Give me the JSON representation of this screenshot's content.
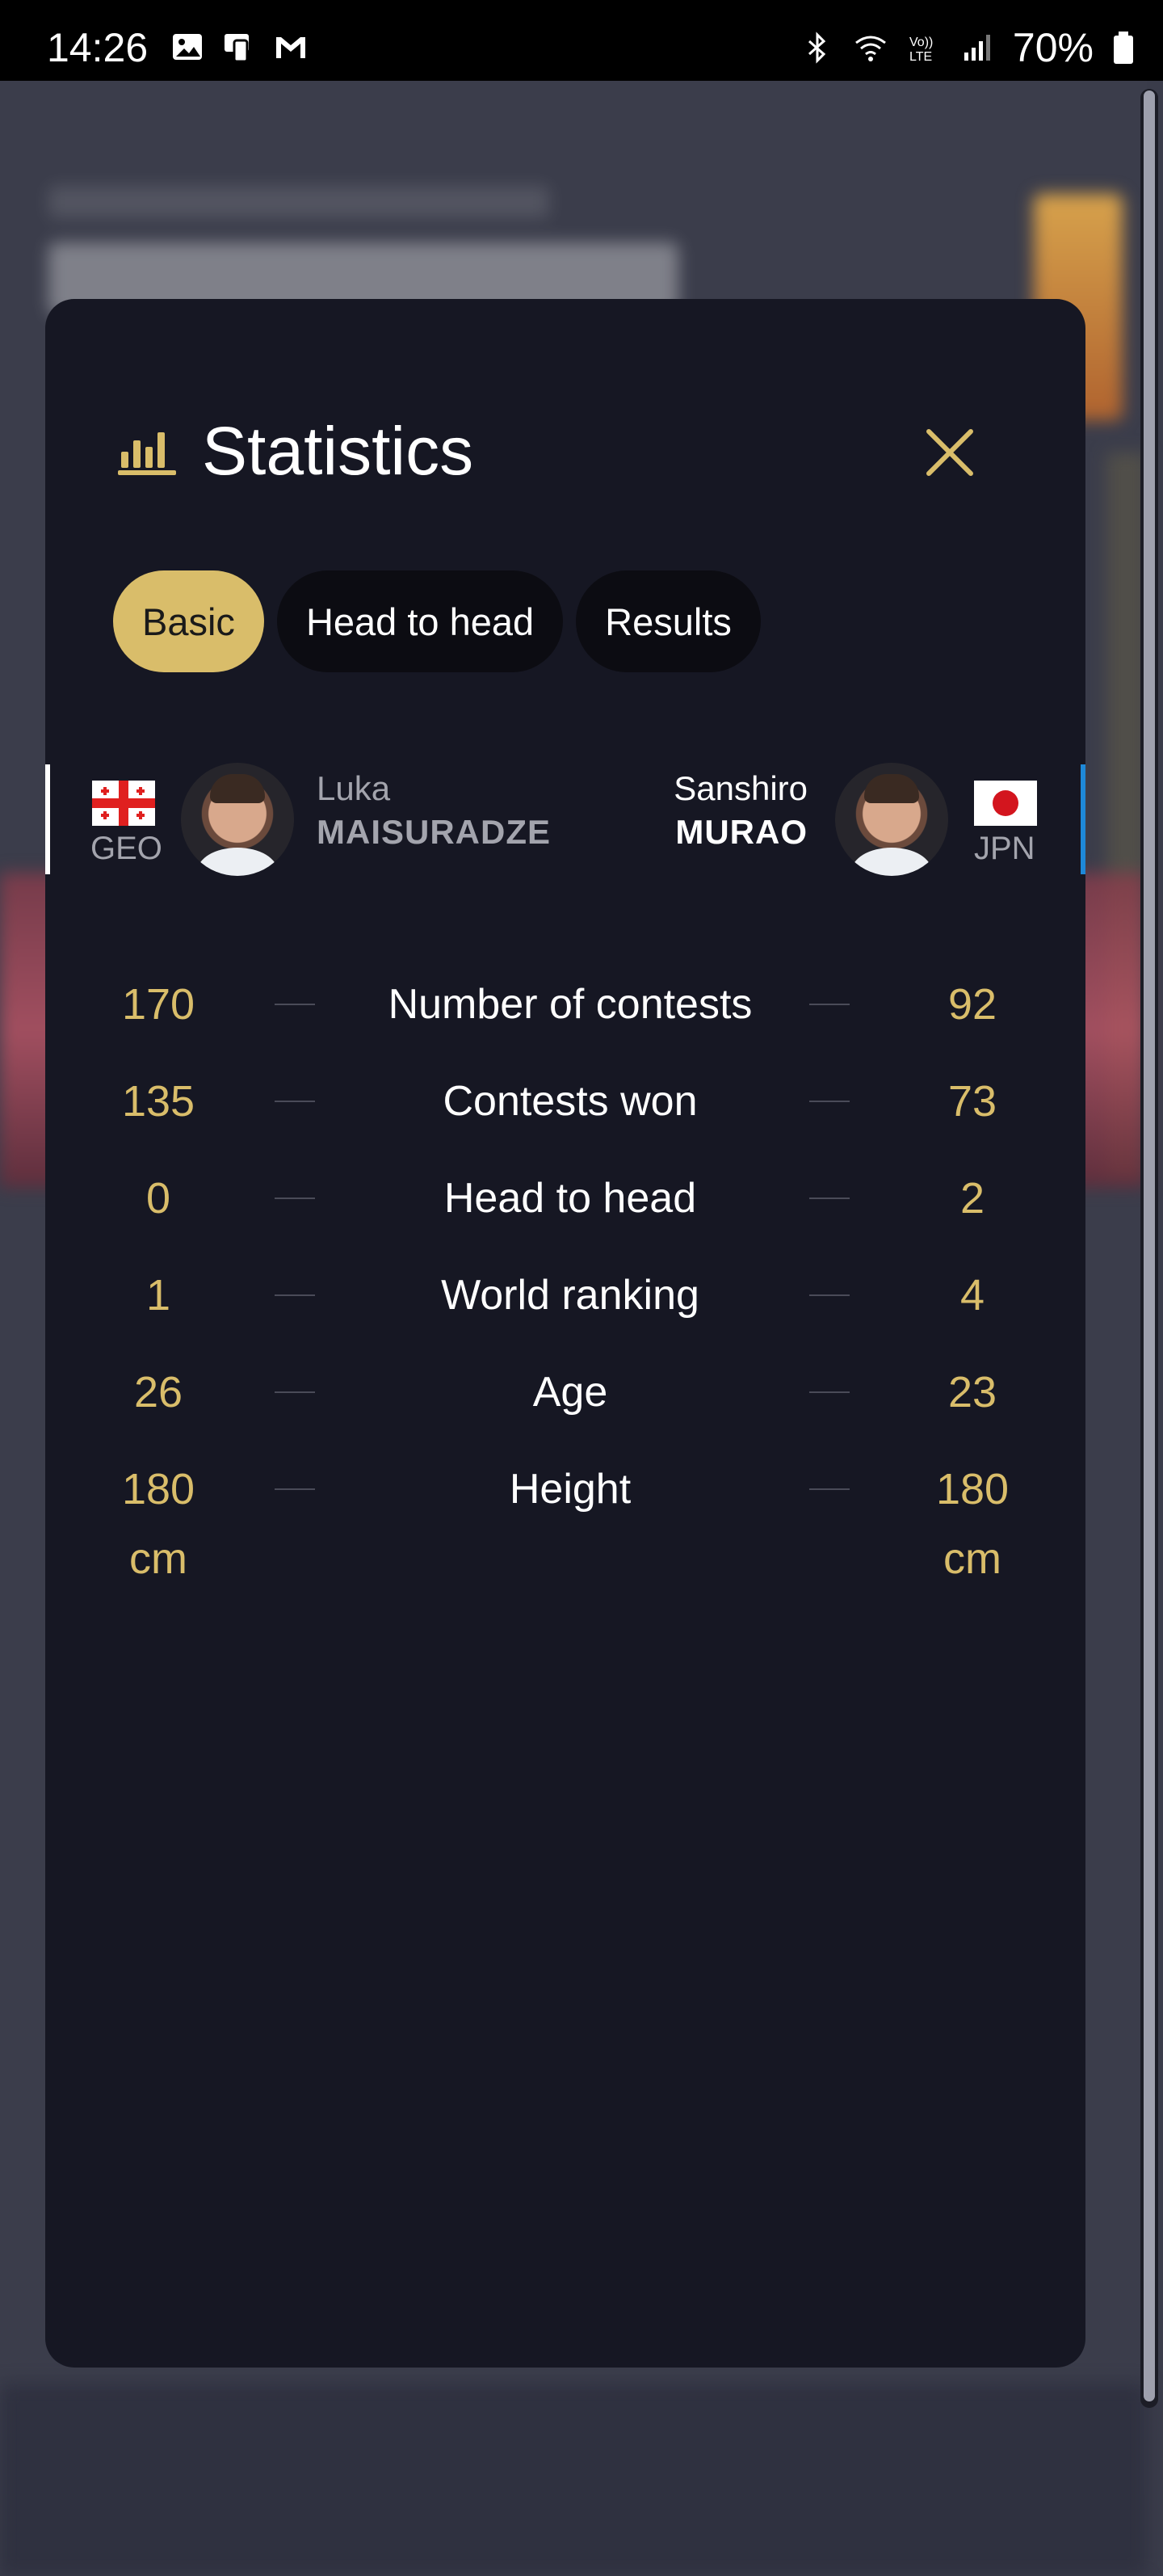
{
  "status_bar": {
    "time": "14:26",
    "battery": "70%",
    "left_icons": [
      "image-icon",
      "cast-icon",
      "gmail-icon"
    ],
    "right_icons": [
      "bluetooth-icon",
      "wifi-icon",
      "volte-icon",
      "signal-icon",
      "battery-icon"
    ]
  },
  "modal": {
    "title": "Statistics",
    "title_icon": "bar-chart-icon",
    "close_icon": "close-icon",
    "tabs": [
      {
        "label": "Basic",
        "active": true
      },
      {
        "label": "Head to head",
        "active": false
      },
      {
        "label": "Results",
        "active": false
      }
    ]
  },
  "athletes": {
    "left": {
      "country": "GEO",
      "first_name": "Luka",
      "last_name": "MAISURADZE",
      "flag": "georgia-flag"
    },
    "right": {
      "country": "JPN",
      "first_name": "Sanshiro",
      "last_name": "MURAO",
      "flag": "japan-flag"
    }
  },
  "stats": [
    {
      "label": "Number of contests",
      "left": "170",
      "right": "92"
    },
    {
      "label": "Contests won",
      "left": "135",
      "right": "73"
    },
    {
      "label": "Head to head",
      "left": "0",
      "right": "2"
    },
    {
      "label": "World ranking",
      "left": "1",
      "right": "4"
    },
    {
      "label": "Age",
      "left": "26",
      "right": "23"
    },
    {
      "label": "Height",
      "left": "180",
      "left_unit": "cm",
      "right": "180",
      "right_unit": "cm"
    }
  ],
  "colors": {
    "accent": "#d9bd6a",
    "modal_bg": "#161723",
    "tab_bg": "#0c0c12",
    "right_athlete_bar": "#1e88d8",
    "left_athlete_bar": "#ffffff"
  }
}
